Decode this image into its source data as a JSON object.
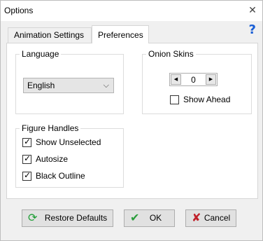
{
  "window": {
    "title": "Options",
    "close_glyph": "✕",
    "help_glyph": "?"
  },
  "tabs": [
    {
      "label": "Animation Settings",
      "active": false
    },
    {
      "label": "Preferences",
      "active": true
    }
  ],
  "language": {
    "group_label": "Language",
    "selected": "English"
  },
  "onion_skins": {
    "group_label": "Onion Skins",
    "value": "0",
    "show_ahead_label": "Show Ahead",
    "show_ahead_checked": false
  },
  "figure_handles": {
    "group_label": "Figure Handles",
    "options": [
      {
        "label": "Show Unselected",
        "checked": true
      },
      {
        "label": "Autosize",
        "checked": true
      },
      {
        "label": "Black Outline",
        "checked": true
      }
    ]
  },
  "buttons": {
    "restore": "Restore Defaults",
    "ok": "OK",
    "cancel": "Cancel"
  },
  "colors": {
    "help": "#1a5fd6",
    "restore_icon": "#1e9e35",
    "ok_icon": "#2a9d3b",
    "cancel_icon": "#c0202a"
  }
}
